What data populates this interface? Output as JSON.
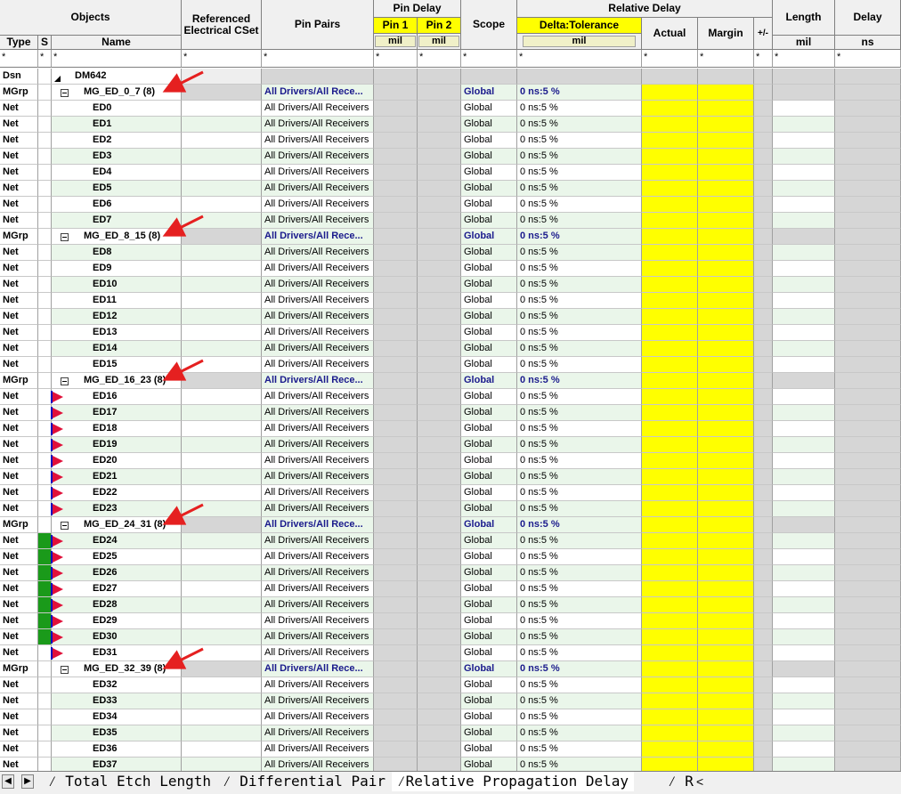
{
  "headers": {
    "objects": "Objects",
    "type": "Type",
    "s": "S",
    "name": "Name",
    "ref_cset": "Referenced Electrical CSet",
    "pin_pairs": "Pin Pairs",
    "pin_delay": "Pin Delay",
    "pin1": "Pin 1",
    "pin2": "Pin 2",
    "scope": "Scope",
    "relative_delay": "Relative Delay",
    "delta_tolerance": "Delta:Tolerance",
    "actual": "Actual",
    "margin": "Margin",
    "plusminus": "+/-",
    "length": "Length",
    "delay": "Delay",
    "unit_mil": "mil",
    "unit_ns": "ns",
    "filter": "*"
  },
  "design": {
    "type": "Dsn",
    "name": "DM642"
  },
  "rows": [
    {
      "type": "MGrp",
      "name": "MG_ED_0_7 (8)",
      "pin_pairs": "All Drivers/All Rece...",
      "scope": "Global",
      "delta": "0 ns:5 %",
      "group": true
    },
    {
      "type": "Net",
      "name": "ED0",
      "pin_pairs": "All Drivers/All Receivers",
      "scope": "Global",
      "delta": "0 ns:5 %"
    },
    {
      "type": "Net",
      "name": "ED1",
      "pin_pairs": "All Drivers/All Receivers",
      "scope": "Global",
      "delta": "0 ns:5 %"
    },
    {
      "type": "Net",
      "name": "ED2",
      "pin_pairs": "All Drivers/All Receivers",
      "scope": "Global",
      "delta": "0 ns:5 %"
    },
    {
      "type": "Net",
      "name": "ED3",
      "pin_pairs": "All Drivers/All Receivers",
      "scope": "Global",
      "delta": "0 ns:5 %"
    },
    {
      "type": "Net",
      "name": "ED4",
      "pin_pairs": "All Drivers/All Receivers",
      "scope": "Global",
      "delta": "0 ns:5 %"
    },
    {
      "type": "Net",
      "name": "ED5",
      "pin_pairs": "All Drivers/All Receivers",
      "scope": "Global",
      "delta": "0 ns:5 %"
    },
    {
      "type": "Net",
      "name": "ED6",
      "pin_pairs": "All Drivers/All Receivers",
      "scope": "Global",
      "delta": "0 ns:5 %"
    },
    {
      "type": "Net",
      "name": "ED7",
      "pin_pairs": "All Drivers/All Receivers",
      "scope": "Global",
      "delta": "0 ns:5 %"
    },
    {
      "type": "MGrp",
      "name": "MG_ED_8_15 (8)",
      "pin_pairs": "All Drivers/All Rece...",
      "scope": "Global",
      "delta": "0 ns:5 %",
      "group": true
    },
    {
      "type": "Net",
      "name": "ED8",
      "pin_pairs": "All Drivers/All Receivers",
      "scope": "Global",
      "delta": "0 ns:5 %"
    },
    {
      "type": "Net",
      "name": "ED9",
      "pin_pairs": "All Drivers/All Receivers",
      "scope": "Global",
      "delta": "0 ns:5 %"
    },
    {
      "type": "Net",
      "name": "ED10",
      "pin_pairs": "All Drivers/All Receivers",
      "scope": "Global",
      "delta": "0 ns:5 %"
    },
    {
      "type": "Net",
      "name": "ED11",
      "pin_pairs": "All Drivers/All Receivers",
      "scope": "Global",
      "delta": "0 ns:5 %"
    },
    {
      "type": "Net",
      "name": "ED12",
      "pin_pairs": "All Drivers/All Receivers",
      "scope": "Global",
      "delta": "0 ns:5 %"
    },
    {
      "type": "Net",
      "name": "ED13",
      "pin_pairs": "All Drivers/All Receivers",
      "scope": "Global",
      "delta": "0 ns:5 %"
    },
    {
      "type": "Net",
      "name": "ED14",
      "pin_pairs": "All Drivers/All Receivers",
      "scope": "Global",
      "delta": "0 ns:5 %"
    },
    {
      "type": "Net",
      "name": "ED15",
      "pin_pairs": "All Drivers/All Receivers",
      "scope": "Global",
      "delta": "0 ns:5 %"
    },
    {
      "type": "MGrp",
      "name": "MG_ED_16_23 (8)",
      "pin_pairs": "All Drivers/All Rece...",
      "scope": "Global",
      "delta": "0 ns:5 %",
      "group": true
    },
    {
      "type": "Net",
      "name": "ED16",
      "pin_pairs": "All Drivers/All Receivers",
      "scope": "Global",
      "delta": "0 ns:5 %",
      "flag": true
    },
    {
      "type": "Net",
      "name": "ED17",
      "pin_pairs": "All Drivers/All Receivers",
      "scope": "Global",
      "delta": "0 ns:5 %",
      "flag": true
    },
    {
      "type": "Net",
      "name": "ED18",
      "pin_pairs": "All Drivers/All Receivers",
      "scope": "Global",
      "delta": "0 ns:5 %",
      "flag": true
    },
    {
      "type": "Net",
      "name": "ED19",
      "pin_pairs": "All Drivers/All Receivers",
      "scope": "Global",
      "delta": "0 ns:5 %",
      "flag": true
    },
    {
      "type": "Net",
      "name": "ED20",
      "pin_pairs": "All Drivers/All Receivers",
      "scope": "Global",
      "delta": "0 ns:5 %",
      "flag": true
    },
    {
      "type": "Net",
      "name": "ED21",
      "pin_pairs": "All Drivers/All Receivers",
      "scope": "Global",
      "delta": "0 ns:5 %",
      "flag": true
    },
    {
      "type": "Net",
      "name": "ED22",
      "pin_pairs": "All Drivers/All Receivers",
      "scope": "Global",
      "delta": "0 ns:5 %",
      "flag": true
    },
    {
      "type": "Net",
      "name": "ED23",
      "pin_pairs": "All Drivers/All Receivers",
      "scope": "Global",
      "delta": "0 ns:5 %",
      "flag": true
    },
    {
      "type": "MGrp",
      "name": "MG_ED_24_31 (8)",
      "pin_pairs": "All Drivers/All Rece...",
      "scope": "Global",
      "delta": "0 ns:5 %",
      "group": true
    },
    {
      "type": "Net",
      "name": "ED24",
      "pin_pairs": "All Drivers/All Receivers",
      "scope": "Global",
      "delta": "0 ns:5 %",
      "flag": true,
      "green": true
    },
    {
      "type": "Net",
      "name": "ED25",
      "pin_pairs": "All Drivers/All Receivers",
      "scope": "Global",
      "delta": "0 ns:5 %",
      "flag": true,
      "green": true
    },
    {
      "type": "Net",
      "name": "ED26",
      "pin_pairs": "All Drivers/All Receivers",
      "scope": "Global",
      "delta": "0 ns:5 %",
      "flag": true,
      "green": true
    },
    {
      "type": "Net",
      "name": "ED27",
      "pin_pairs": "All Drivers/All Receivers",
      "scope": "Global",
      "delta": "0 ns:5 %",
      "flag": true,
      "green": true
    },
    {
      "type": "Net",
      "name": "ED28",
      "pin_pairs": "All Drivers/All Receivers",
      "scope": "Global",
      "delta": "0 ns:5 %",
      "flag": true,
      "green": true
    },
    {
      "type": "Net",
      "name": "ED29",
      "pin_pairs": "All Drivers/All Receivers",
      "scope": "Global",
      "delta": "0 ns:5 %",
      "flag": true,
      "green": true
    },
    {
      "type": "Net",
      "name": "ED30",
      "pin_pairs": "All Drivers/All Receivers",
      "scope": "Global",
      "delta": "0 ns:5 %",
      "flag": true,
      "green": true
    },
    {
      "type": "Net",
      "name": "ED31",
      "pin_pairs": "All Drivers/All Receivers",
      "scope": "Global",
      "delta": "0 ns:5 %",
      "flag": true
    },
    {
      "type": "MGrp",
      "name": "MG_ED_32_39 (8)",
      "pin_pairs": "All Drivers/All Rece...",
      "scope": "Global",
      "delta": "0 ns:5 %",
      "group": true
    },
    {
      "type": "Net",
      "name": "ED32",
      "pin_pairs": "All Drivers/All Receivers",
      "scope": "Global",
      "delta": "0 ns:5 %"
    },
    {
      "type": "Net",
      "name": "ED33",
      "pin_pairs": "All Drivers/All Receivers",
      "scope": "Global",
      "delta": "0 ns:5 %"
    },
    {
      "type": "Net",
      "name": "ED34",
      "pin_pairs": "All Drivers/All Receivers",
      "scope": "Global",
      "delta": "0 ns:5 %"
    },
    {
      "type": "Net",
      "name": "ED35",
      "pin_pairs": "All Drivers/All Receivers",
      "scope": "Global",
      "delta": "0 ns:5 %"
    },
    {
      "type": "Net",
      "name": "ED36",
      "pin_pairs": "All Drivers/All Receivers",
      "scope": "Global",
      "delta": "0 ns:5 %"
    },
    {
      "type": "Net",
      "name": "ED37",
      "pin_pairs": "All Drivers/All Receivers",
      "scope": "Global",
      "delta": "0 ns:5 %"
    }
  ],
  "tabs": {
    "items": [
      "Total Etch Length",
      "Differential Pair",
      "Relative Propagation Delay",
      "R"
    ],
    "active_index": 2
  },
  "colors": {
    "row_green": "#eaf6ea",
    "group_blue": "#1a1a8c",
    "yellow": "#ffff00",
    "grey_cell": "#d6d6d6",
    "flag_red": "#e0103a",
    "status_green": "#1a9a1a",
    "arrow_red": "#e52020"
  }
}
